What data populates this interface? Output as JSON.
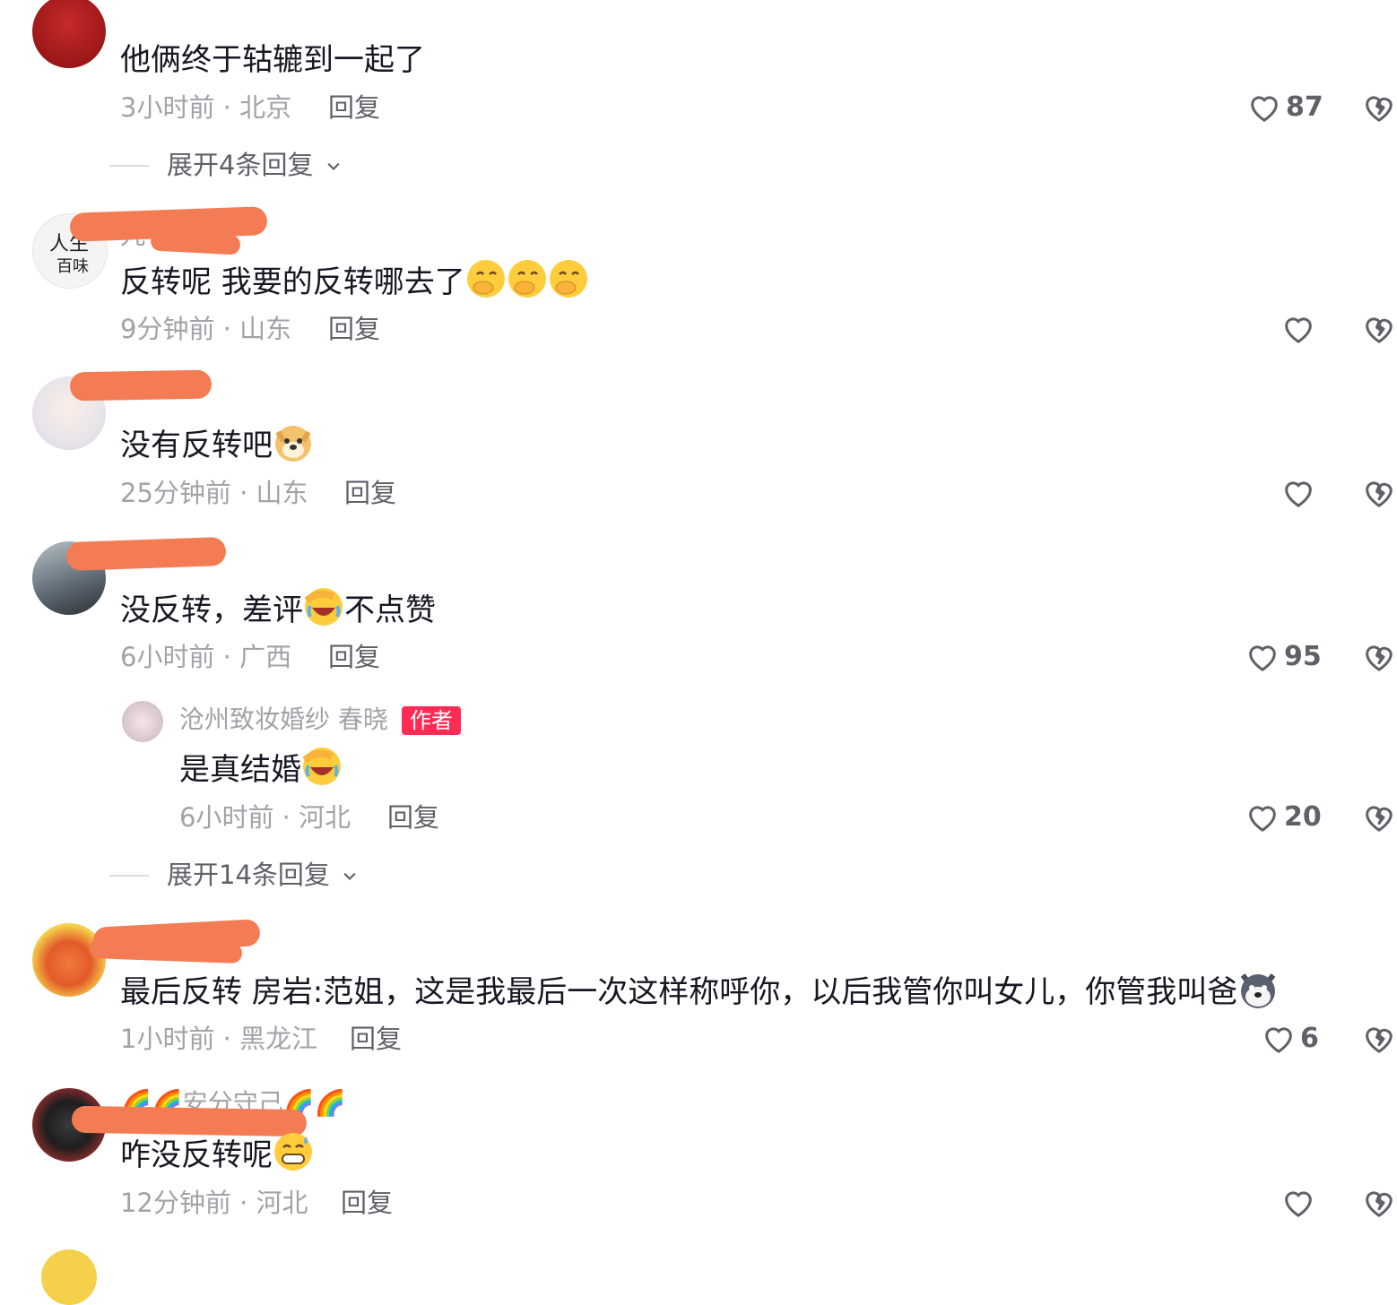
{
  "comments": [
    {
      "text": "他俩终于轱辘到一起了",
      "meta": "3小时前 · 北京",
      "reply_label": "回复",
      "likes": "87",
      "expand_label": "展开4条回复"
    },
    {
      "username_fragment": "九",
      "text": "反转呢  我要的反转哪去了",
      "meta": "9分钟前 · 山东",
      "reply_label": "回复",
      "likes": ""
    },
    {
      "text": "没有反转吧",
      "meta": "25分钟前 · 山东",
      "reply_label": "回复",
      "likes": ""
    },
    {
      "text_part1": "没反转，差评",
      "text_part2": "不点赞",
      "meta": "6小时前 · 广西",
      "reply_label": "回复",
      "likes": "95",
      "sub_reply": {
        "username": "沧州致妆婚纱 春晓",
        "badge": "作者",
        "text": "是真结婚",
        "meta": "6小时前 · 河北",
        "reply_label": "回复",
        "likes": "20"
      },
      "expand_label": "展开14条回复"
    },
    {
      "text": "最后反转  房岩:范姐，这是我最后一次这样称呼你，以后我管你叫女儿，你管我叫爸",
      "meta": "1小时前 · 黑龙江",
      "reply_label": "回复",
      "likes": "6"
    },
    {
      "username": "安分守己",
      "text": "咋没反转呢",
      "meta": "12分钟前 · 河北",
      "reply_label": "回复",
      "likes": ""
    }
  ],
  "colors": {
    "redaction": "#f47c55",
    "author_badge": "#fe2c55",
    "meta_text": "#a2a3a8"
  },
  "icons": [
    "heart-outline-icon",
    "broken-heart-icon",
    "chevron-down-icon"
  ]
}
